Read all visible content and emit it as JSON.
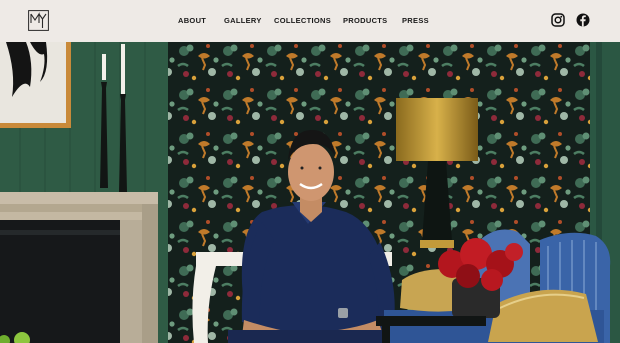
{
  "brand": {
    "logo_icon": "my-monogram-logo",
    "logo_text": "MY"
  },
  "nav": {
    "items": [
      {
        "label": "ABOUT"
      },
      {
        "label": "GALLERY"
      },
      {
        "label": "COLLECTIONS"
      },
      {
        "label": "PRODUCTS"
      },
      {
        "label": "PRESS"
      }
    ]
  },
  "social": {
    "instagram_icon": "instagram-icon",
    "facebook_icon": "facebook-icon"
  },
  "hero": {
    "image": "designer-portrait-in-patterned-room",
    "colors": {
      "wall_green": "#2e5a44",
      "wallpaper_dark": "#14201c",
      "shirt_navy": "#1b2c5a",
      "sofa_blue": "#3a64a8",
      "cushion_gold": "#c8a552",
      "flowers_red": "#b3161e"
    }
  }
}
